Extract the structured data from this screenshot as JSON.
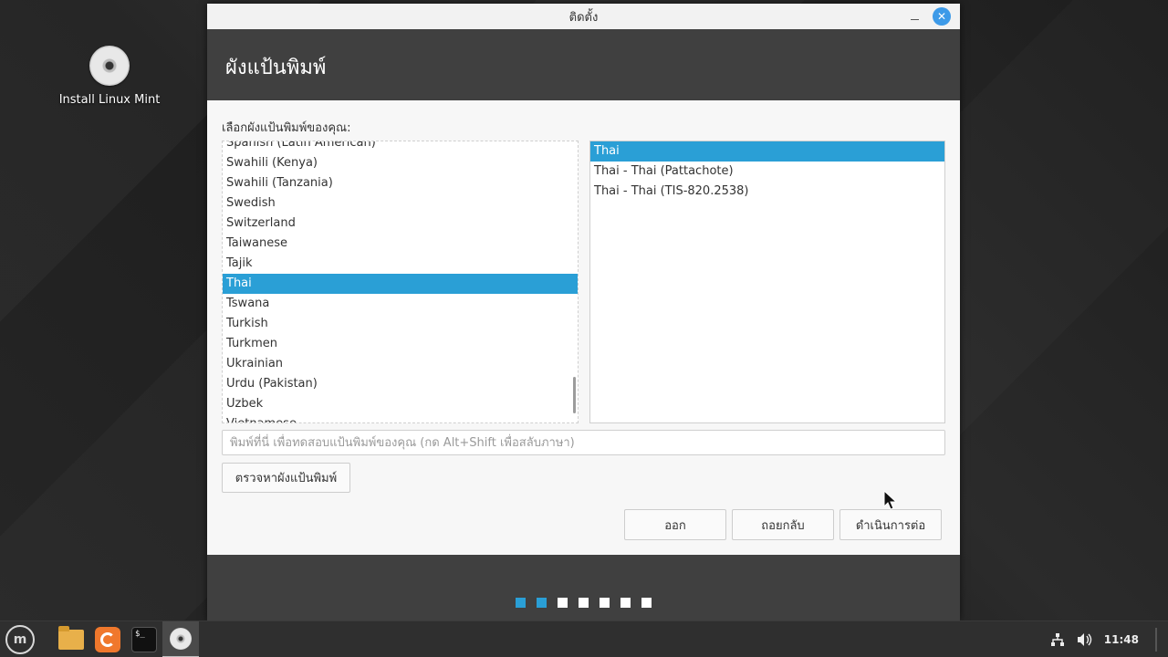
{
  "desktop": {
    "icon_label": "Install Linux Mint"
  },
  "window": {
    "title": "ติดตั้ง",
    "close_glyph": "✕"
  },
  "header": {
    "title": "ผังแป้นพิมพ์"
  },
  "content": {
    "prompt": "เลือกผังแป้นพิมพ์ของคุณ:",
    "layouts": [
      {
        "label": "Spanish (Latin American)",
        "selected": false
      },
      {
        "label": "Swahili (Kenya)",
        "selected": false
      },
      {
        "label": "Swahili (Tanzania)",
        "selected": false
      },
      {
        "label": "Swedish",
        "selected": false
      },
      {
        "label": "Switzerland",
        "selected": false
      },
      {
        "label": "Taiwanese",
        "selected": false
      },
      {
        "label": "Tajik",
        "selected": false
      },
      {
        "label": "Thai",
        "selected": true
      },
      {
        "label": "Tswana",
        "selected": false
      },
      {
        "label": "Turkish",
        "selected": false
      },
      {
        "label": "Turkmen",
        "selected": false
      },
      {
        "label": "Ukrainian",
        "selected": false
      },
      {
        "label": "Urdu (Pakistan)",
        "selected": false
      },
      {
        "label": "Uzbek",
        "selected": false
      },
      {
        "label": "Vietnamese",
        "selected": false
      }
    ],
    "variants": [
      {
        "label": "Thai",
        "selected": true
      },
      {
        "label": "Thai - Thai (Pattachote)",
        "selected": false
      },
      {
        "label": "Thai - Thai (TIS-820.2538)",
        "selected": false
      }
    ],
    "test_placeholder": "พิมพ์ที่นี่ เพื่อทดสอบแป้นพิมพ์ของคุณ (กด Alt+Shift เพื่อสลับภาษา)",
    "test_value": "",
    "detect_label": "ตรวจหาผังแป้นพิมพ์",
    "quit_label": "ออก",
    "back_label": "ถอยกลับ",
    "continue_label": "ดำเนินการต่อ"
  },
  "progress": {
    "total_steps": 7,
    "completed_steps": 2
  },
  "taskbar": {
    "clock": "11:48",
    "terminal_glyph": "$_"
  },
  "colors": {
    "accent": "#2a9fd6",
    "window_dark": "#404040"
  }
}
